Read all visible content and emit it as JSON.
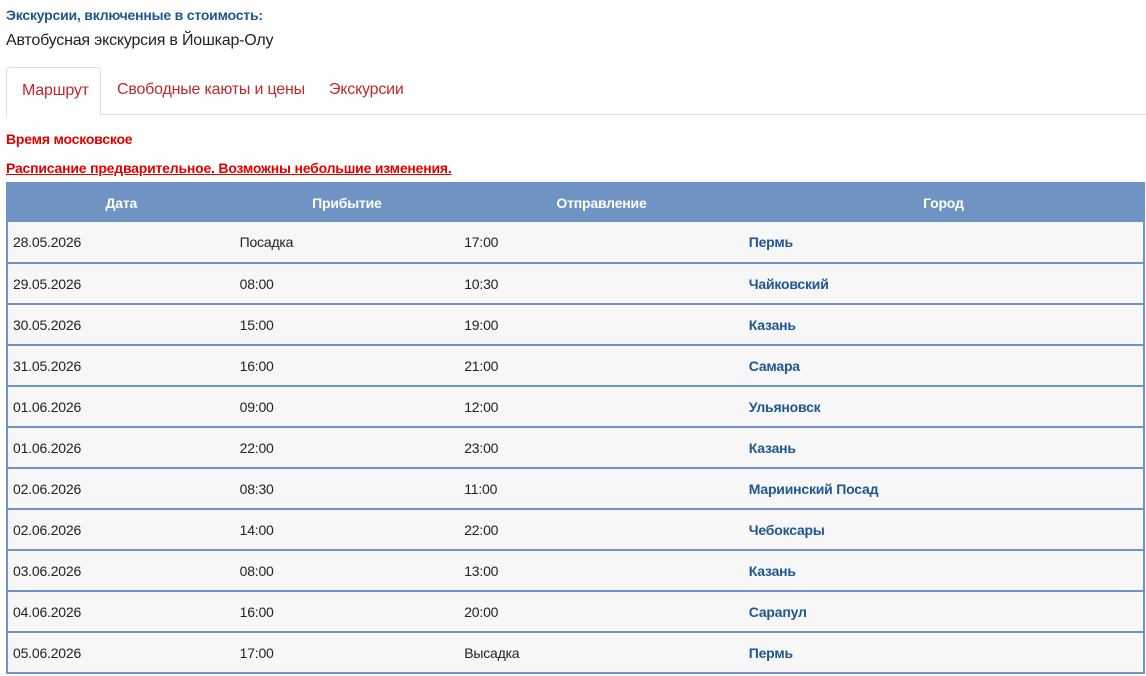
{
  "included": {
    "title": "Экскурсии, включенные в стоимость:",
    "item": "Автобусная экскурсия в Йошкар-Олу"
  },
  "tabs": [
    {
      "label": "Маршрут",
      "active": true
    },
    {
      "label": "Свободные каюты и цены",
      "active": false
    },
    {
      "label": "Экскурсии",
      "active": false
    }
  ],
  "notes": {
    "time": "Время московское",
    "schedule": "Расписание предварительное. Возможны небольшие изменения."
  },
  "table": {
    "headers": [
      "Дата",
      "Прибытие",
      "Отправление",
      "Город"
    ],
    "rows": [
      {
        "date": "28.05.2026",
        "arrival": "Посадка",
        "departure": "17:00",
        "city": "Пермь"
      },
      {
        "date": "29.05.2026",
        "arrival": "08:00",
        "departure": "10:30",
        "city": "Чайковский"
      },
      {
        "date": "30.05.2026",
        "arrival": "15:00",
        "departure": "19:00",
        "city": "Казань"
      },
      {
        "date": "31.05.2026",
        "arrival": "16:00",
        "departure": "21:00",
        "city": "Самара"
      },
      {
        "date": "01.06.2026",
        "arrival": "09:00",
        "departure": "12:00",
        "city": "Ульяновск"
      },
      {
        "date": "01.06.2026",
        "arrival": "22:00",
        "departure": "23:00",
        "city": "Казань"
      },
      {
        "date": "02.06.2026",
        "arrival": "08:30",
        "departure": "11:00",
        "city": "Мариинский Посад"
      },
      {
        "date": "02.06.2026",
        "arrival": "14:00",
        "departure": "22:00",
        "city": "Чебоксары"
      },
      {
        "date": "03.06.2026",
        "arrival": "08:00",
        "departure": "13:00",
        "city": "Казань"
      },
      {
        "date": "04.06.2026",
        "arrival": "16:00",
        "departure": "20:00",
        "city": "Сарапул"
      },
      {
        "date": "05.06.2026",
        "arrival": "17:00",
        "departure": "Высадка",
        "city": "Пермь"
      }
    ]
  },
  "colors": {
    "accent_blue": "#1f5690",
    "header_bg": "#6f93c2",
    "tab_red": "#c0282d",
    "warning_red": "#e00000"
  }
}
